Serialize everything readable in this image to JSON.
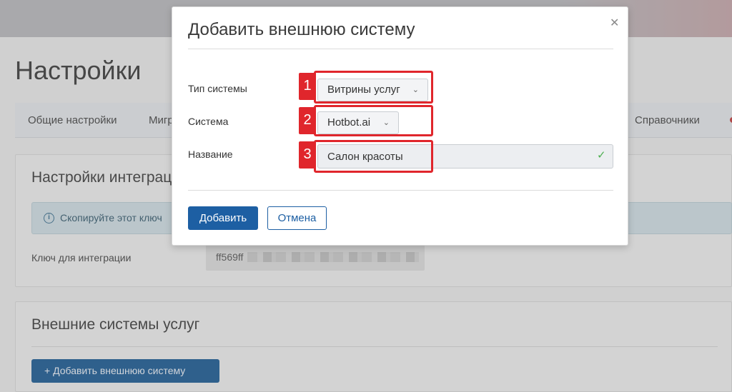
{
  "page": {
    "title": "Настройки",
    "tabs": [
      "Общие настройки",
      "Миграция",
      "Справочники"
    ]
  },
  "integration": {
    "title": "Настройки интеграции",
    "info_text": "Скопируйте этот ключ",
    "key_label": "Ключ для интеграции",
    "key_value": "ff569ff"
  },
  "external": {
    "title": "Внешние системы услуг",
    "add_button": "+ Добавить внешнюю систему"
  },
  "modal": {
    "title": "Добавить внешнюю систему",
    "fields": {
      "type_label": "Тип системы",
      "type_value": "Витрины услуг",
      "system_label": "Система",
      "system_value": "Hotbot.ai",
      "name_label": "Название",
      "name_value": "Салон красоты"
    },
    "add_button": "Добавить",
    "cancel_button": "Отмена"
  },
  "annotations": [
    "1",
    "2",
    "3"
  ],
  "colors": {
    "primary": "#1d5fa3",
    "annotation": "#e0262c",
    "valid": "#4caf50"
  },
  "icons": {
    "close": "close-icon",
    "chevron": "chevron-down-icon",
    "check": "check-icon",
    "info": "info-icon",
    "plus": "plus-icon"
  }
}
